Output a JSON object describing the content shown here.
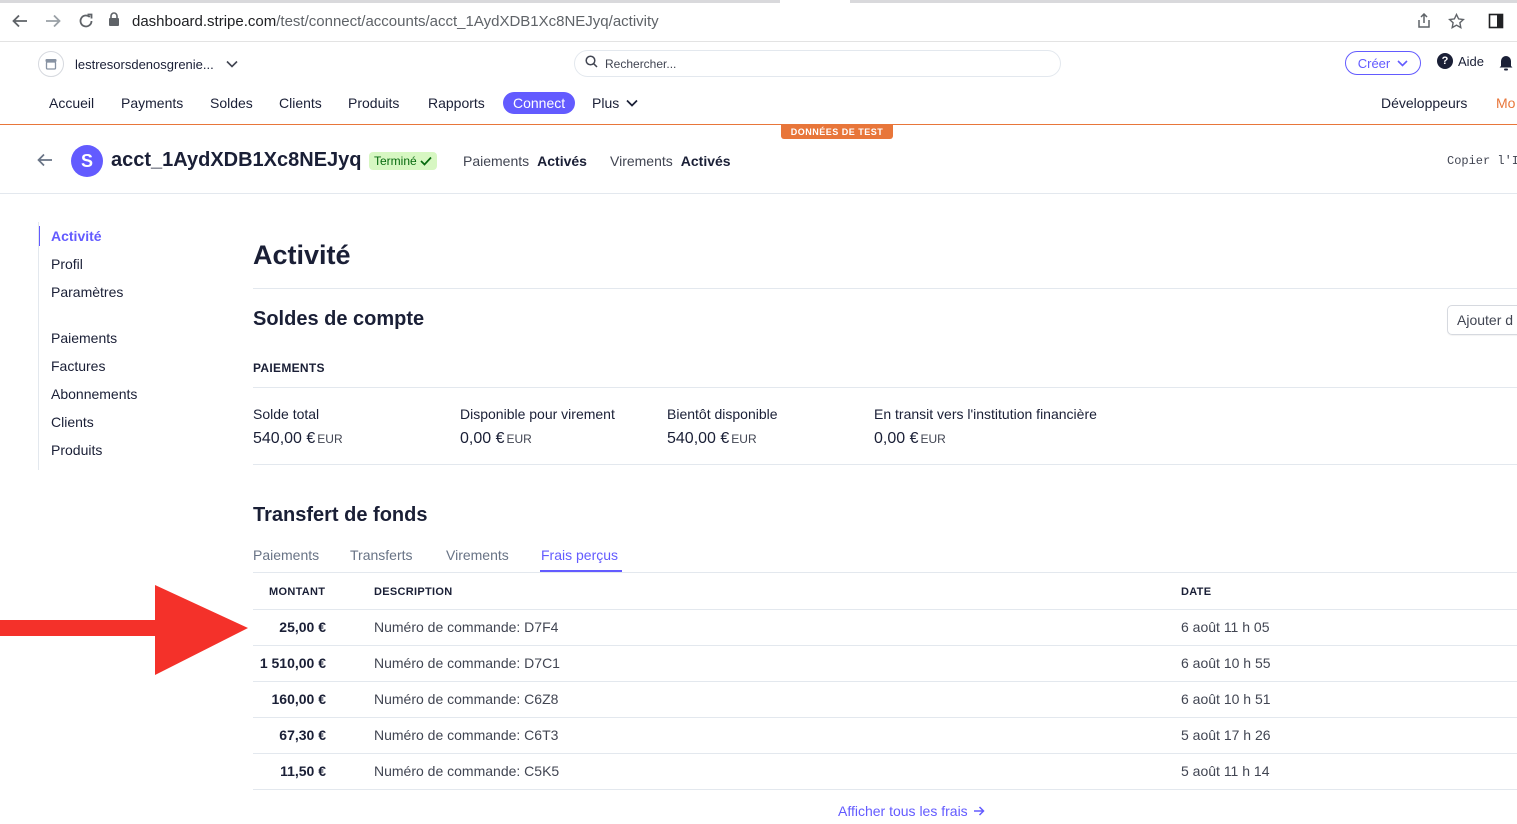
{
  "browser": {
    "url_host": "dashboard.stripe.com",
    "url_path": "/test/connect/accounts/acct_1AydXDB1Xc8NEJyq/activity"
  },
  "topbar": {
    "account_name": "lestresorsdenosgrenie...",
    "search_placeholder": "Rechercher...",
    "create_label": "Créer",
    "help_label": "Aide"
  },
  "nav": {
    "items": [
      "Accueil",
      "Payments",
      "Soldes",
      "Clients",
      "Produits",
      "Rapports",
      "Connect",
      "Plus"
    ],
    "active": "Connect",
    "right": [
      "Développeurs",
      "Mo"
    ]
  },
  "test_badge": "DONNÉES DE TEST",
  "account": {
    "avatar_letter": "S",
    "id": "acct_1AydXDB1Xc8NEJyq",
    "status": "Terminé",
    "payments_label": "Paiements",
    "payments_value": "Activés",
    "payouts_label": "Virements",
    "payouts_value": "Activés",
    "copy_label": "Copier l'I"
  },
  "sidebar": {
    "group1": [
      "Activité",
      "Profil",
      "Paramètres"
    ],
    "group2": [
      "Paiements",
      "Factures",
      "Abonnements",
      "Clients",
      "Produits"
    ],
    "active": "Activité"
  },
  "page": {
    "title": "Activité",
    "balances_title": "Soldes de compte",
    "add_button": "Ajouter d",
    "payments_label": "PAIEMENTS",
    "balances": [
      {
        "label": "Solde total",
        "amount": "540,00 €",
        "currency": "EUR"
      },
      {
        "label": "Disponible pour virement",
        "amount": "0,00 €",
        "currency": "EUR"
      },
      {
        "label": "Bientôt disponible",
        "amount": "540,00 €",
        "currency": "EUR"
      },
      {
        "label": "En transit vers l'institution financière",
        "amount": "0,00 €",
        "currency": "EUR"
      }
    ],
    "transfer_title": "Transfert de fonds",
    "tabs": [
      "Paiements",
      "Transferts",
      "Virements",
      "Frais perçus"
    ],
    "active_tab": "Frais perçus",
    "table": {
      "headers": [
        "MONTANT",
        "DESCRIPTION",
        "DATE"
      ],
      "rows": [
        {
          "amount": "25,00 €",
          "description": "Numéro de commande: D7F4",
          "date": "6 août 11 h 05"
        },
        {
          "amount": "1 510,00 €",
          "description": "Numéro de commande: D7C1",
          "date": "6 août 10 h 55"
        },
        {
          "amount": "160,00 €",
          "description": "Numéro de commande: C6Z8",
          "date": "6 août 10 h 51"
        },
        {
          "amount": "67,30 €",
          "description": "Numéro de commande: C6T3",
          "date": "5 août 17 h 26"
        },
        {
          "amount": "11,50 €",
          "description": "Numéro de commande: C5K5",
          "date": "5 août 11 h 14"
        }
      ]
    },
    "view_all": "Afficher tous les frais"
  },
  "colors": {
    "accent": "#635bff",
    "test_orange": "#e8763a",
    "annotation_red": "#f4312a"
  }
}
